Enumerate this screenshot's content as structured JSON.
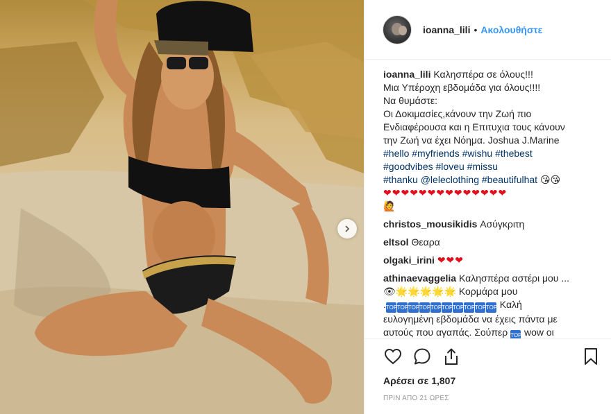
{
  "header": {
    "username": "ioanna_lili",
    "separator": "•",
    "follow_label": "Ακολουθήστε"
  },
  "caption": {
    "username": "ioanna_lili",
    "lines": [
      "Καλησπέρα σε όλους!!!",
      "Μια Υπέροχη εβδομάδα για όλους!!!!",
      "Να θυμάστε:",
      "Οι Δοκιμασίες,κάνουν την Ζωή πιο",
      "Ενδιαφέρουσα και η Επιτυχια τους κάνουν",
      "την Ζωή να έχει Νόημα. Joshua J.Marine"
    ],
    "hashtags_line1": [
      "#hello",
      "#myfriends",
      "#wishu",
      "#thebest"
    ],
    "hashtags_line2": [
      "#goodvibes",
      "#loveu",
      "#missu"
    ],
    "hashtags_line3": [
      "#thanku",
      "@leleclothing",
      "#beautifulhat"
    ],
    "emoji_line3": "😘😘",
    "hearts": "❤❤❤❤❤❤❤❤❤❤❤❤❤❤",
    "emoji_end": "🙋"
  },
  "comments": [
    {
      "username": "christos_mousikidis",
      "text": "Ασύγκριτη"
    },
    {
      "username": "eltsol",
      "text": "Θεαρα"
    },
    {
      "username": "olgaki_irini",
      "text": "❤❤❤"
    },
    {
      "username": "athinaevaggelia",
      "text": "Καλησπέρα αστέρι μου ...",
      "line2_eye": "👁",
      "line2_sparkles": "🌟🌟🌟🌟🌟",
      "line2_text": "Κορμάρα μου",
      "line3_dot": ".",
      "top_label": "TOP",
      "line3_text": "Καλή",
      "line4": "ευλογημένη εβδομάδα να έχεις πάντα με",
      "line5_text": "αυτούς που αγαπάς. Σούπερ",
      "line5_end": "wow οι"
    }
  ],
  "actions": {
    "like_icon": "heart-outline-icon",
    "comment_icon": "comment-bubble-icon",
    "share_icon": "share-upload-icon",
    "save_icon": "bookmark-icon"
  },
  "likes_label": "Αρέσει σε 1,807",
  "timestamp": "ΠΡΙΝ ΑΠΟ 21 ΩΡΕΣ",
  "colors": {
    "link_blue": "#3897f0",
    "hashtag_navy": "#003569",
    "heart_red": "#e0101f",
    "border": "#efefef"
  }
}
